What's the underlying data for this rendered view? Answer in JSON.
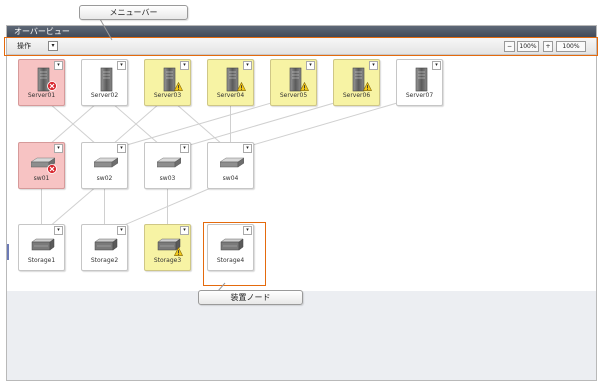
{
  "window_title": "オーバービュー",
  "menubar": {
    "operation_label": "操作",
    "dropdown_symbol": "▾",
    "zoom_out_symbol": "−",
    "zoom_value": "100%",
    "zoom_in_symbol": "+",
    "zoom_reset_label": "100%"
  },
  "annotations": {
    "menubar_callout": "メニューバー",
    "node_callout": "装置ノード"
  },
  "colors": {
    "error_bg": "#f7c3c3",
    "warning_bg": "#f7f3a4",
    "highlight": "#e46a0d"
  },
  "nodes": [
    {
      "label": "Server01",
      "kind": "server",
      "state": "error"
    },
    {
      "label": "Server02",
      "kind": "server",
      "state": "normal"
    },
    {
      "label": "Server03",
      "kind": "server",
      "state": "warning"
    },
    {
      "label": "Server04",
      "kind": "server",
      "state": "warning"
    },
    {
      "label": "Server05",
      "kind": "server",
      "state": "warning"
    },
    {
      "label": "Server06",
      "kind": "server",
      "state": "warning"
    },
    {
      "label": "Server07",
      "kind": "server",
      "state": "normal"
    },
    {
      "label": "sw01",
      "kind": "switch",
      "state": "error"
    },
    {
      "label": "sw02",
      "kind": "switch",
      "state": "normal"
    },
    {
      "label": "sw03",
      "kind": "switch",
      "state": "normal"
    },
    {
      "label": "sw04",
      "kind": "switch",
      "state": "normal"
    },
    {
      "label": "Storage1",
      "kind": "storage",
      "state": "normal"
    },
    {
      "label": "Storage2",
      "kind": "storage",
      "state": "normal"
    },
    {
      "label": "Storage3",
      "kind": "storage",
      "state": "warning"
    },
    {
      "label": "Storage4",
      "kind": "storage",
      "state": "normal"
    }
  ],
  "node_menu_symbol": "▾"
}
